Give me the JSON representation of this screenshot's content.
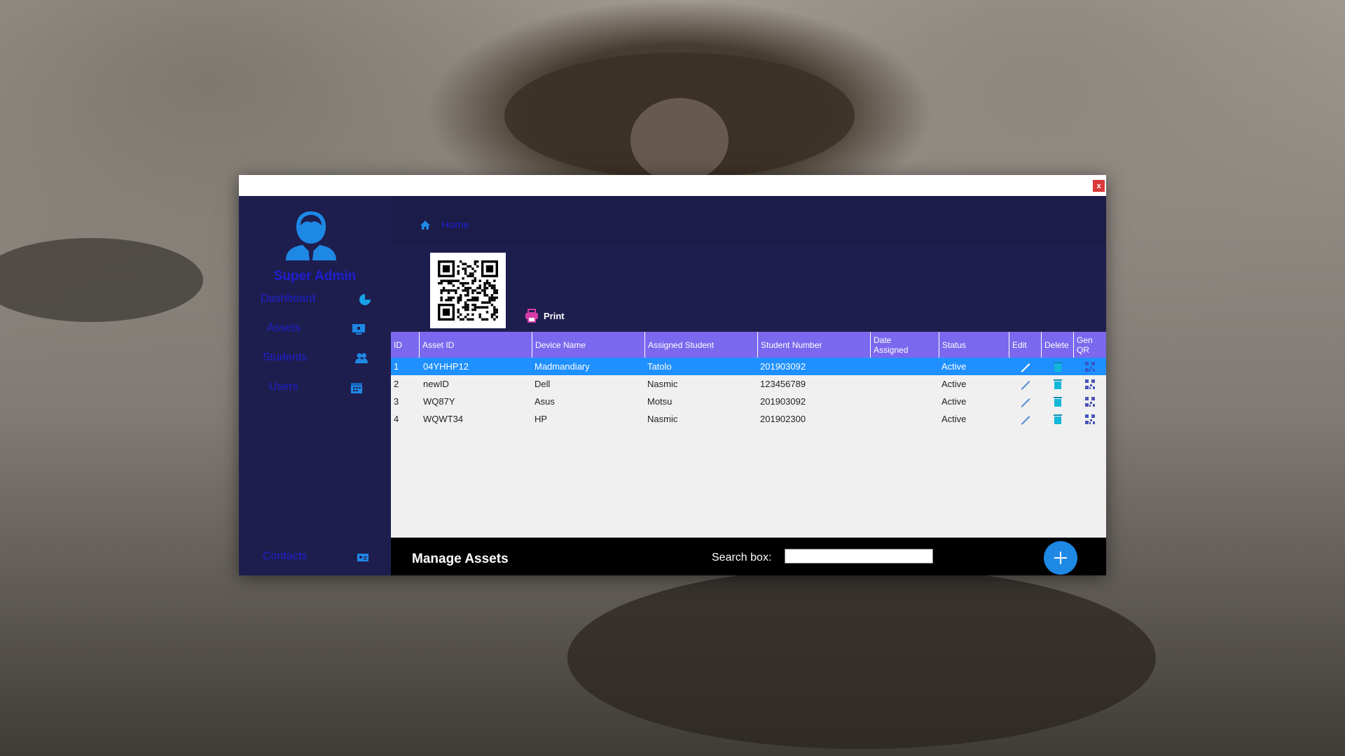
{
  "window": {
    "close_label": "x"
  },
  "sidebar": {
    "role": "Super Admin",
    "items": [
      {
        "label": "Dashboard",
        "icon": "pie-chart-icon"
      },
      {
        "label": "Assets",
        "icon": "monitor-icon"
      },
      {
        "label": "Students",
        "icon": "users-icon"
      },
      {
        "label": "Users",
        "icon": "calendar-icon"
      }
    ],
    "contacts": {
      "label": "Contacts",
      "icon": "contact-card-icon"
    }
  },
  "breadcrumb": {
    "home": "Home"
  },
  "print": {
    "label": "Print"
  },
  "table": {
    "columns": {
      "id": "ID",
      "asset_id": "Asset ID",
      "device_name": "Device Name",
      "assigned_student": "Assigned Student",
      "student_number": "Student Number",
      "date_assigned_1": "Date",
      "date_assigned_2": "Assigned",
      "status": "Status",
      "edit": "Edit",
      "delete": "Delete",
      "genqr_1": "Gen",
      "genqr_2": "QR"
    },
    "rows": [
      {
        "id": "1",
        "asset_id": "04YHHP12",
        "device_name": "Madmandiary",
        "assigned_student": "Tatolo",
        "student_number": "201903092",
        "date_assigned": "",
        "status": "Active"
      },
      {
        "id": "2",
        "asset_id": "newID",
        "device_name": "Dell",
        "assigned_student": "Nasmic",
        "student_number": "123456789",
        "date_assigned": "",
        "status": "Active"
      },
      {
        "id": "3",
        "asset_id": "WQ87Y",
        "device_name": "Asus",
        "assigned_student": "Motsu",
        "student_number": "201903092",
        "date_assigned": "",
        "status": "Active"
      },
      {
        "id": "4",
        "asset_id": "WQWT34",
        "device_name": "HP",
        "assigned_student": "Nasmic",
        "student_number": "201902300",
        "date_assigned": "",
        "status": "Active"
      }
    ],
    "selected_row": 1
  },
  "footer": {
    "title": "Manage Assets",
    "search_label": "Search box:",
    "search_value": ""
  },
  "colors": {
    "navy": "#1e1e4e",
    "header_purple": "#7b68ee",
    "selected_blue": "#1e90ff",
    "accent_blue": "#1e88e5",
    "nav_text": "#1f1fd1",
    "print_magenta": "#d63aa8"
  }
}
